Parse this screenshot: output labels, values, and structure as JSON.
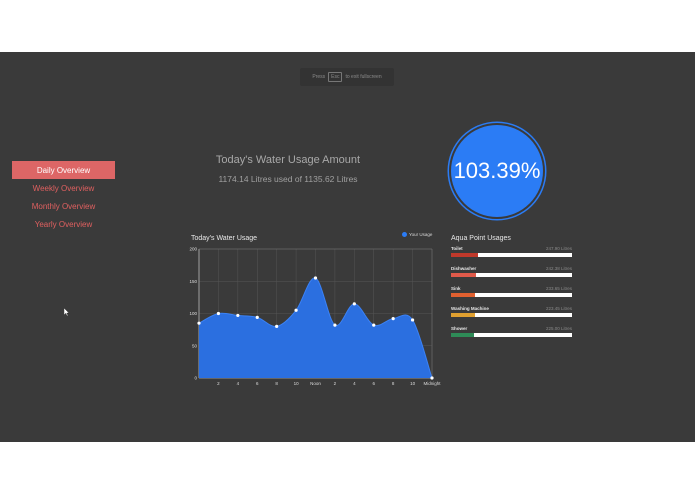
{
  "fullscreen_hint": {
    "press": "Press",
    "key": "Esc",
    "rest": "to exit fullscreen"
  },
  "nav": {
    "items": [
      {
        "label": "Daily Overview",
        "active": true
      },
      {
        "label": "Weekly Overview",
        "active": false
      },
      {
        "label": "Monthly Overview",
        "active": false
      },
      {
        "label": "Yearly Overview",
        "active": false
      }
    ]
  },
  "usage": {
    "title": "Today's Water Usage Amount",
    "subtitle": "1174.14 Litres used of 1135.62 Litres",
    "percent": "103.39%"
  },
  "colors": {
    "accent": "#2b7cf5",
    "nav_active": "#dd6666",
    "nav_text": "#e06060",
    "background": "#3a3a3a"
  },
  "chart_data": {
    "type": "area",
    "title": "Today's Water Usage",
    "legend": "Your Usage",
    "legend_position": "top-right",
    "x": [
      "",
      "2",
      "4",
      "6",
      "8",
      "10",
      "Noon",
      "2",
      "4",
      "6",
      "8",
      "10",
      "Midnight"
    ],
    "values": [
      85,
      100,
      97,
      94,
      80,
      105,
      155,
      82,
      115,
      82,
      92,
      90,
      0
    ],
    "ylim": [
      0,
      200
    ],
    "yticks": [
      0,
      50,
      100,
      150,
      200
    ],
    "grid": true
  },
  "aqua_points": {
    "title": "Aqua Point Usages",
    "items": [
      {
        "name": "Toilet",
        "value": "247.90 Litres",
        "fraction": 0.22,
        "color": "#c0392b"
      },
      {
        "name": "Dishwasher",
        "value": "242.38 Litres",
        "fraction": 0.21,
        "color": "#e05a4a"
      },
      {
        "name": "Sink",
        "value": "233.65 Litres",
        "fraction": 0.2,
        "color": "#e06030"
      },
      {
        "name": "Washing Machine",
        "value": "223.45 Litres",
        "fraction": 0.2,
        "color": "#e0a030"
      },
      {
        "name": "Shower",
        "value": "225.00 Litres",
        "fraction": 0.19,
        "color": "#2e8b57"
      }
    ]
  }
}
